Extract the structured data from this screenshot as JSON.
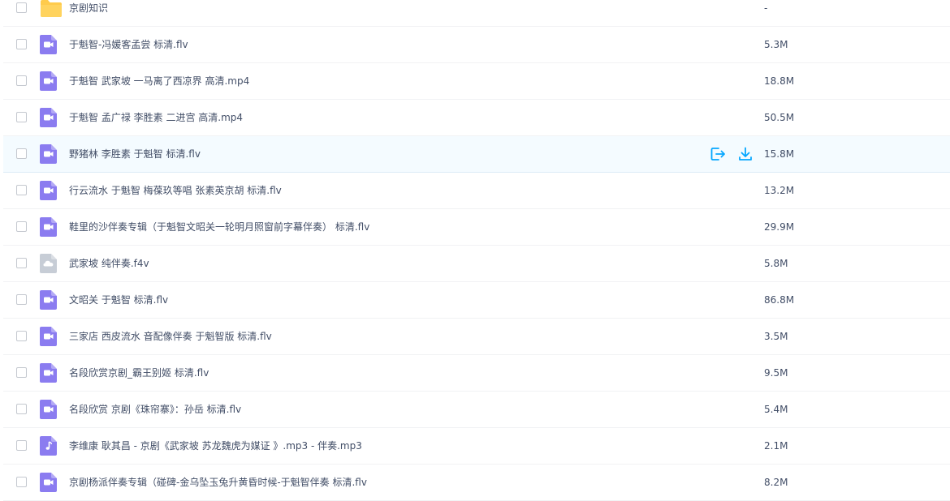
{
  "colors": {
    "accent": "#06a7ff",
    "video_icon": "#8b7cf0",
    "folder_icon": "#ffcb4c",
    "unknown_icon": "#c7cdd6",
    "hover_row": "#f4fbff"
  },
  "files": [
    {
      "icon": "folder-icon",
      "name": "京剧知识",
      "size": "-"
    },
    {
      "icon": "video-file-icon",
      "name": "于魁智-冯媛客孟尝 标清.flv",
      "size": "5.3M"
    },
    {
      "icon": "video-file-icon",
      "name": "于魁智 武家坡 一马离了西凉界 高清.mp4",
      "size": "18.8M"
    },
    {
      "icon": "video-file-icon",
      "name": "于魁智 孟广禄 李胜素 二进宫 高清.mp4",
      "size": "50.5M"
    },
    {
      "icon": "video-file-icon",
      "name": "野猪林 李胜素 于魁智 标清.flv",
      "size": "15.8M",
      "hover": true
    },
    {
      "icon": "video-file-icon",
      "name": "行云流水 于魁智 梅葆玖等唱 张素英京胡 标清.flv",
      "size": "13.2M"
    },
    {
      "icon": "video-file-icon",
      "name": "鞋里的沙伴奏专辑（于魁智文昭关一轮明月照窗前字幕伴奏） 标清.flv",
      "size": "29.9M"
    },
    {
      "icon": "cloud-file-icon",
      "name": "武家坡 纯伴奏.f4v",
      "size": "5.8M"
    },
    {
      "icon": "video-file-icon",
      "name": "文昭关 于魁智 标清.flv",
      "size": "86.8M"
    },
    {
      "icon": "video-file-icon",
      "name": "三家店 西皮流水 音配像伴奏 于魁智版 标清.flv",
      "size": "3.5M"
    },
    {
      "icon": "video-file-icon",
      "name": "名段欣赏京剧_霸王别姬 标清.flv",
      "size": "9.5M"
    },
    {
      "icon": "video-file-icon",
      "name": "名段欣赏 京剧《珠帘寨》：孙岳 标清.flv",
      "size": "5.4M"
    },
    {
      "icon": "audio-file-icon",
      "name": "李维康 耿其昌 - 京剧《武家坡 苏龙魏虎为媒证 》.mp3 - 伴奏.mp3",
      "size": "2.1M"
    },
    {
      "icon": "video-file-icon",
      "name": "京剧杨派伴奏专辑（碰碑-金乌坠玉兔升黄昏时候-于魁智伴奏 标清.flv",
      "size": "8.2M"
    }
  ],
  "hover_actions": [
    {
      "icon": "share-export-icon"
    },
    {
      "icon": "download-icon"
    }
  ]
}
